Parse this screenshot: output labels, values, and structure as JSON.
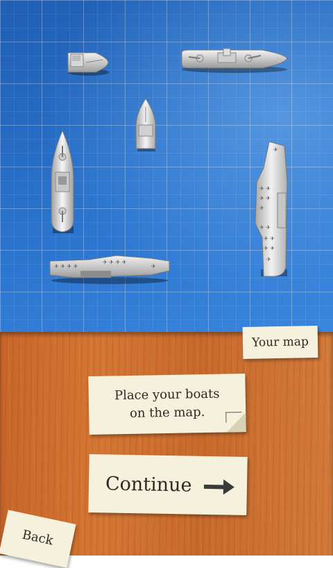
{
  "map": {
    "ships": [
      {
        "name": "small-boat",
        "orientation": "horizontal"
      },
      {
        "name": "battleship",
        "orientation": "horizontal"
      },
      {
        "name": "patrol-boat",
        "orientation": "vertical"
      },
      {
        "name": "destroyer",
        "orientation": "vertical"
      },
      {
        "name": "carrier",
        "orientation": "vertical"
      },
      {
        "name": "carrier",
        "orientation": "horizontal"
      }
    ]
  },
  "labels": {
    "your_map": "Your map",
    "instruction_line1": "Place your boats",
    "instruction_line2": "on the map.",
    "continue": "Continue",
    "back": "Back"
  },
  "colors": {
    "sea": "#2a74cf",
    "wood": "#d07434",
    "paper": "#f6f1dc",
    "ink": "#2e2a24"
  }
}
